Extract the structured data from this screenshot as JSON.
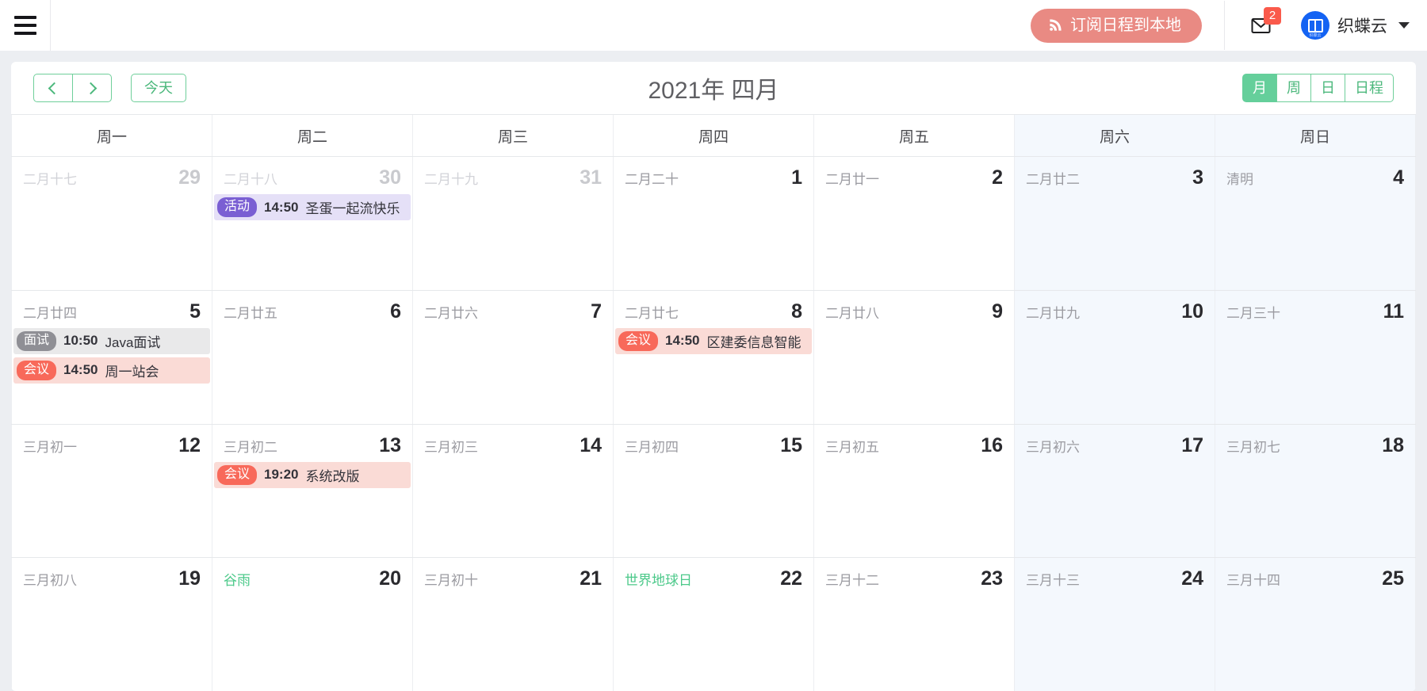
{
  "topbar": {
    "menu_icon": "hamburger-icon",
    "subscribe_label": "订阅日程到本地",
    "subscribe_icon": "rss-icon",
    "subscribe_color": "#e98a83",
    "mail_icon": "mail-icon",
    "mail_badge": "2",
    "mail_badge_color": "#fa5a4b",
    "avatar_icon": "brand-logo-icon",
    "avatar_caption": "织蝶云",
    "avatar_color": "#1463f3",
    "user_name": "织蝶云",
    "caret_icon": "chevron-down-icon"
  },
  "toolbar": {
    "prev_icon": "chevron-left-icon",
    "next_icon": "chevron-right-icon",
    "prev_label": "",
    "next_label": "",
    "today_label": "今天",
    "title": "2021年 四月",
    "accent_color": "#65cf9b",
    "views": [
      {
        "label": "月",
        "active": true
      },
      {
        "label": "周",
        "active": false
      },
      {
        "label": "日",
        "active": false
      },
      {
        "label": "日程",
        "active": false
      }
    ]
  },
  "weekdays": [
    {
      "label": "周一",
      "weekend": false
    },
    {
      "label": "周二",
      "weekend": false
    },
    {
      "label": "周三",
      "weekend": false
    },
    {
      "label": "周四",
      "weekend": false
    },
    {
      "label": "周五",
      "weekend": false
    },
    {
      "label": "周六",
      "weekend": true
    },
    {
      "label": "周日",
      "weekend": true
    }
  ],
  "weeks": [
    {
      "days": [
        {
          "num": "29",
          "lunar": "二月十七",
          "other": true,
          "weekend": false,
          "special": false,
          "events": []
        },
        {
          "num": "30",
          "lunar": "二月十八",
          "other": true,
          "weekend": false,
          "special": false,
          "events": [
            {
              "tag": "活动",
              "time": "14:50",
              "title": "圣蛋一起流快乐",
              "color": "purple"
            }
          ]
        },
        {
          "num": "31",
          "lunar": "二月十九",
          "other": true,
          "weekend": false,
          "special": false,
          "events": []
        },
        {
          "num": "1",
          "lunar": "二月二十",
          "other": false,
          "weekend": false,
          "special": false,
          "events": []
        },
        {
          "num": "2",
          "lunar": "二月廿一",
          "other": false,
          "weekend": false,
          "special": false,
          "events": []
        },
        {
          "num": "3",
          "lunar": "二月廿二",
          "other": false,
          "weekend": true,
          "special": false,
          "events": []
        },
        {
          "num": "4",
          "lunar": "清明",
          "other": false,
          "weekend": true,
          "special": false,
          "events": []
        }
      ]
    },
    {
      "days": [
        {
          "num": "5",
          "lunar": "二月廿四",
          "other": false,
          "weekend": false,
          "special": false,
          "events": [
            {
              "tag": "面试",
              "time": "10:50",
              "title": "Java面试",
              "color": "gray"
            },
            {
              "tag": "会议",
              "time": "14:50",
              "title": "周一站会",
              "color": "red"
            }
          ]
        },
        {
          "num": "6",
          "lunar": "二月廿五",
          "other": false,
          "weekend": false,
          "special": false,
          "events": []
        },
        {
          "num": "7",
          "lunar": "二月廿六",
          "other": false,
          "weekend": false,
          "special": false,
          "events": []
        },
        {
          "num": "8",
          "lunar": "二月廿七",
          "other": false,
          "weekend": false,
          "special": false,
          "events": [
            {
              "tag": "会议",
              "time": "14:50",
              "title": "区建委信息智能",
              "color": "red"
            }
          ]
        },
        {
          "num": "9",
          "lunar": "二月廿八",
          "other": false,
          "weekend": false,
          "special": false,
          "events": []
        },
        {
          "num": "10",
          "lunar": "二月廿九",
          "other": false,
          "weekend": true,
          "special": false,
          "events": []
        },
        {
          "num": "11",
          "lunar": "二月三十",
          "other": false,
          "weekend": true,
          "special": false,
          "events": []
        }
      ]
    },
    {
      "days": [
        {
          "num": "12",
          "lunar": "三月初一",
          "other": false,
          "weekend": false,
          "special": false,
          "events": []
        },
        {
          "num": "13",
          "lunar": "三月初二",
          "other": false,
          "weekend": false,
          "special": false,
          "events": [
            {
              "tag": "会议",
              "time": "19:20",
              "title": "系统改版",
              "color": "red"
            }
          ]
        },
        {
          "num": "14",
          "lunar": "三月初三",
          "other": false,
          "weekend": false,
          "special": false,
          "events": []
        },
        {
          "num": "15",
          "lunar": "三月初四",
          "other": false,
          "weekend": false,
          "special": false,
          "events": []
        },
        {
          "num": "16",
          "lunar": "三月初五",
          "other": false,
          "weekend": false,
          "special": false,
          "events": []
        },
        {
          "num": "17",
          "lunar": "三月初六",
          "other": false,
          "weekend": true,
          "special": false,
          "events": []
        },
        {
          "num": "18",
          "lunar": "三月初七",
          "other": false,
          "weekend": true,
          "special": false,
          "events": []
        }
      ]
    },
    {
      "days": [
        {
          "num": "19",
          "lunar": "三月初八",
          "other": false,
          "weekend": false,
          "special": false,
          "events": []
        },
        {
          "num": "20",
          "lunar": "谷雨",
          "other": false,
          "weekend": false,
          "special": true,
          "events": []
        },
        {
          "num": "21",
          "lunar": "三月初十",
          "other": false,
          "weekend": false,
          "special": false,
          "events": []
        },
        {
          "num": "22",
          "lunar": "世界地球日",
          "other": false,
          "weekend": false,
          "special": true,
          "events": []
        },
        {
          "num": "23",
          "lunar": "三月十二",
          "other": false,
          "weekend": false,
          "special": false,
          "events": []
        },
        {
          "num": "24",
          "lunar": "三月十三",
          "other": false,
          "weekend": true,
          "special": false,
          "events": []
        },
        {
          "num": "25",
          "lunar": "三月十四",
          "other": false,
          "weekend": true,
          "special": false,
          "events": []
        }
      ]
    }
  ]
}
